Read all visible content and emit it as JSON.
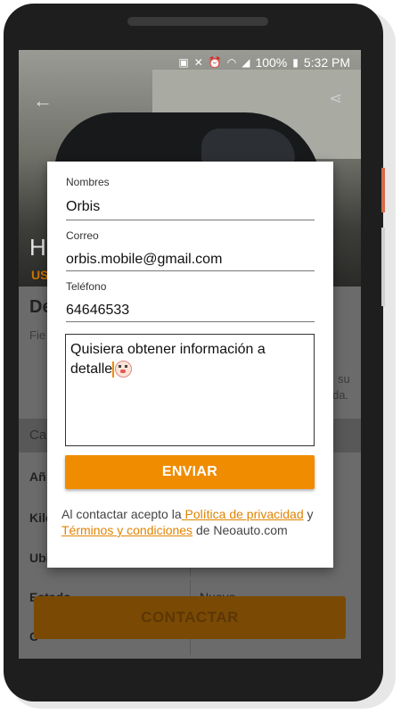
{
  "status_bar": {
    "battery": "100%",
    "time": "5:32 PM"
  },
  "background": {
    "title_fragment": "H",
    "orange_fragment": "US",
    "section_head": "De",
    "paragraph": "Fie hex por pos ver",
    "paragraph_right_1": "su",
    "paragraph_right_2": "da.",
    "category_label": "Ca",
    "rows": [
      {
        "label": "Añ",
        "value": ""
      },
      {
        "label": "Kile",
        "value": ""
      },
      {
        "label": "Ubi",
        "value": ""
      },
      {
        "label": "Estado",
        "value": "Nuevo"
      },
      {
        "label": "C",
        "value": ""
      }
    ],
    "contact_button": "CONTACTAR"
  },
  "dialog": {
    "name_label": "Nombres",
    "name_value": "Orbis",
    "email_label": "Correo",
    "email_value": "orbis.mobile@gmail.com",
    "phone_label": "Teléfono",
    "phone_value": "64646533",
    "message_line1": "Quisiera obtener información a",
    "message_line2": "detalle",
    "send_button": "ENVIAR",
    "legal_prefix": "Al contactar acepto la",
    "privacy_link": " Política de privacidad",
    "legal_and": " y",
    "terms_link": " Términos y condiciones",
    "legal_suffix": " de Neoauto.com"
  },
  "colors": {
    "accent": "#f08c00"
  }
}
